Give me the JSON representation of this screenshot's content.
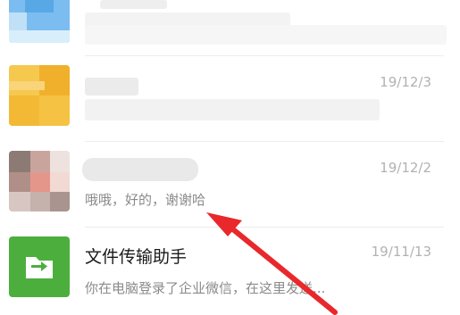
{
  "chats": [
    {
      "name": "",
      "date": "",
      "preview": ""
    },
    {
      "name": "",
      "date": "19/12/3",
      "preview": ""
    },
    {
      "name": "",
      "date": "19/12/2",
      "preview": "哦哦，好的，谢谢哈"
    },
    {
      "name": "文件传输助手",
      "date": "19/11/13",
      "preview": "你在电脑登录了企业微信，在这里发送..."
    }
  ],
  "icons": {
    "folder": "folder-icon"
  },
  "colors": {
    "annotation_arrow": "#e8282b",
    "file_transfer_green": "#4caf3d"
  }
}
